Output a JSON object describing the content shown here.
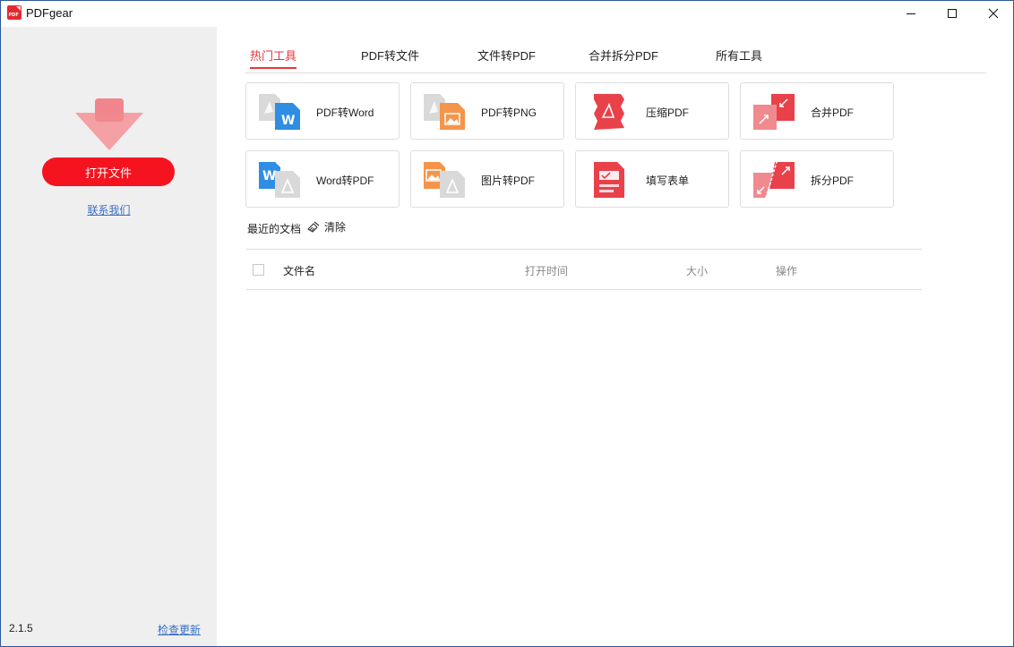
{
  "window": {
    "title": "PDFgear",
    "logo_text": "PDF"
  },
  "sidebar": {
    "open_button": "打开文件",
    "contact_link": "联系我们",
    "version": "2.1.5",
    "update_link": "检查更新"
  },
  "tabs": [
    {
      "label": "热门工具",
      "active": true
    },
    {
      "label": "PDF转文件",
      "active": false
    },
    {
      "label": "文件转PDF",
      "active": false
    },
    {
      "label": "合并拆分PDF",
      "active": false
    },
    {
      "label": "所有工具",
      "active": false
    }
  ],
  "tools": [
    {
      "label": "PDF转Word",
      "icon": "pdf-to-word-icon"
    },
    {
      "label": "PDF转PNG",
      "icon": "pdf-to-png-icon"
    },
    {
      "label": "压缩PDF",
      "icon": "compress-pdf-icon"
    },
    {
      "label": "合并PDF",
      "icon": "merge-pdf-icon"
    },
    {
      "label": "Word转PDF",
      "icon": "word-to-pdf-icon"
    },
    {
      "label": "图片转PDF",
      "icon": "image-to-pdf-icon"
    },
    {
      "label": "填写表单",
      "icon": "fill-form-icon"
    },
    {
      "label": "拆分PDF",
      "icon": "split-pdf-icon"
    }
  ],
  "recent": {
    "title": "最近的文档",
    "clear": "清除",
    "columns": {
      "name": "文件名",
      "open_time": "打开时间",
      "size": "大小",
      "action": "操作"
    }
  },
  "colors": {
    "accent": "#e8343a",
    "button": "#f5131f",
    "link": "#3a6fc4",
    "sidebar_bg": "#efefef"
  }
}
